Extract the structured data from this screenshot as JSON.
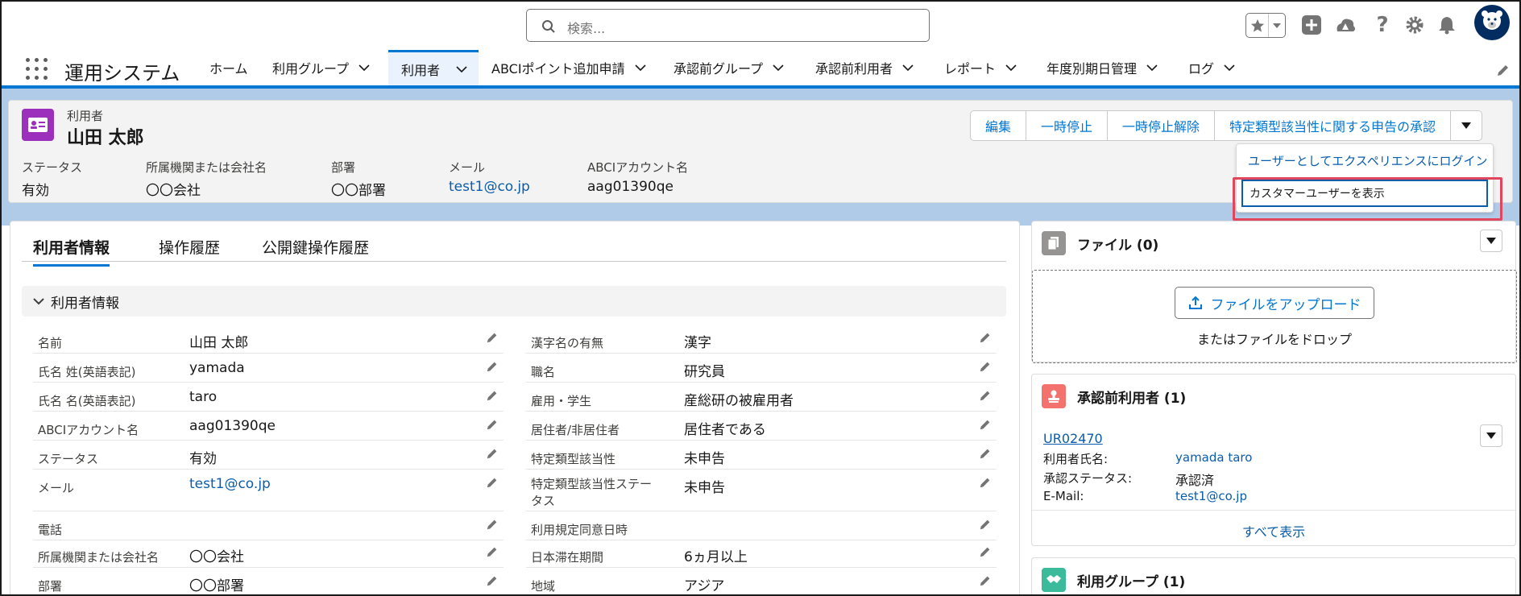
{
  "header": {
    "search_placeholder": "検索...",
    "app_name": "運用システム"
  },
  "nav": {
    "items": [
      {
        "label": "ホーム"
      },
      {
        "label": "利用グループ"
      },
      {
        "label": "利用者"
      },
      {
        "label": "ABCIポイント追加申請"
      },
      {
        "label": "承認前グループ"
      },
      {
        "label": "承認前利用者"
      },
      {
        "label": "レポート"
      },
      {
        "label": "年度別期日管理"
      },
      {
        "label": "ログ"
      }
    ],
    "active_index": 2
  },
  "record": {
    "object_label": "利用者",
    "name": "山田 太郎",
    "buttons": [
      "編集",
      "一時停止",
      "一時停止解除",
      "特定類型該当性に関する申告の承認"
    ],
    "fields": [
      {
        "label": "ステータス",
        "value": "有効"
      },
      {
        "label": "所属機関または会社名",
        "value": "〇〇会社"
      },
      {
        "label": "部署",
        "value": "〇〇部署"
      },
      {
        "label": "メール",
        "value": "test1@co.jp"
      },
      {
        "label": "ABCIアカウント名",
        "value": "aag01390qe"
      }
    ]
  },
  "menu": {
    "items": [
      "ユーザーとしてエクスペリエンスにログイン",
      "カスタマーユーザーを表示"
    ]
  },
  "tabs": [
    "利用者情報",
    "操作履歴",
    "公開鍵操作履歴"
  ],
  "section": {
    "title": "利用者情報",
    "left": [
      {
        "label": "名前",
        "value": "山田 太郎"
      },
      {
        "label": "氏名 姓(英語表記)",
        "value": "yamada"
      },
      {
        "label": "氏名 名(英語表記)",
        "value": "taro"
      },
      {
        "label": "ABCIアカウント名",
        "value": "aag01390qe"
      },
      {
        "label": "ステータス",
        "value": "有効"
      },
      {
        "label": "メール",
        "value": "test1@co.jp"
      },
      {
        "label": "電話",
        "value": ""
      },
      {
        "label": "所属機関または会社名",
        "value": "〇〇会社"
      },
      {
        "label": "部署",
        "value": "〇〇部署"
      }
    ],
    "right": [
      {
        "label": "漢字名の有無",
        "value": "漢字"
      },
      {
        "label": "職名",
        "value": "研究員"
      },
      {
        "label": "雇用・学生",
        "value": "産総研の被雇用者"
      },
      {
        "label": "居住者/非居住者",
        "value": "居住者である"
      },
      {
        "label": "特定類型該当性",
        "value": "未申告"
      },
      {
        "label": "特定類型該当性ステータス",
        "value": "未申告"
      },
      {
        "label": "利用規定同意日時",
        "value": ""
      },
      {
        "label": "日本滞在期間",
        "value": "6ヵ月以上"
      },
      {
        "label": "地域",
        "value": "アジア"
      }
    ]
  },
  "files": {
    "title": "ファイル (0)",
    "upload_label": "ファイルをアップロード",
    "drop_text": "またはファイルをドロップ"
  },
  "pending_users": {
    "title": "承認前利用者 (1)",
    "record_id": "UR02470",
    "rows": [
      {
        "label": "利用者氏名:",
        "value": "yamada taro"
      },
      {
        "label": "承認ステータス:",
        "value": "承認済"
      },
      {
        "label": "E-Mail:",
        "value": "test1@co.jp"
      }
    ],
    "view_all": "すべて表示"
  },
  "groups": {
    "title": "利用グループ (1)"
  },
  "colors": {
    "brand": "#0176d3",
    "record_icon": "#9c30bd",
    "files_icon": "#7f8de1",
    "pending_icon": "#f4726e",
    "groups_icon": "#3bba9c",
    "highlight": "#e0475f"
  }
}
